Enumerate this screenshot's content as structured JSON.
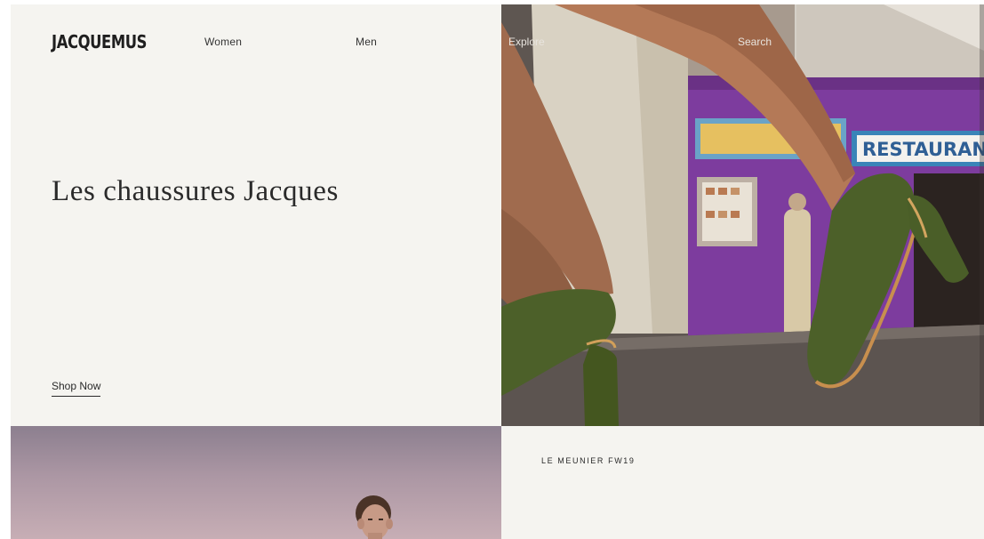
{
  "brand": {
    "logo": "JACQUEMUS"
  },
  "nav": {
    "women": "Women",
    "men": "Men",
    "explore": "Explore",
    "search": "Search"
  },
  "hero": {
    "title": "Les chaussures Jacques",
    "cta": "Shop Now",
    "image_label": "RESTAURANT"
  },
  "collection": {
    "title": "LE MEUNIER FW19"
  },
  "colors": {
    "panel_bg": "#f5f4f0",
    "text": "#2a2a2a",
    "shoe_green": "#4c6029",
    "restaurant_purple": "#7d3c9e"
  }
}
